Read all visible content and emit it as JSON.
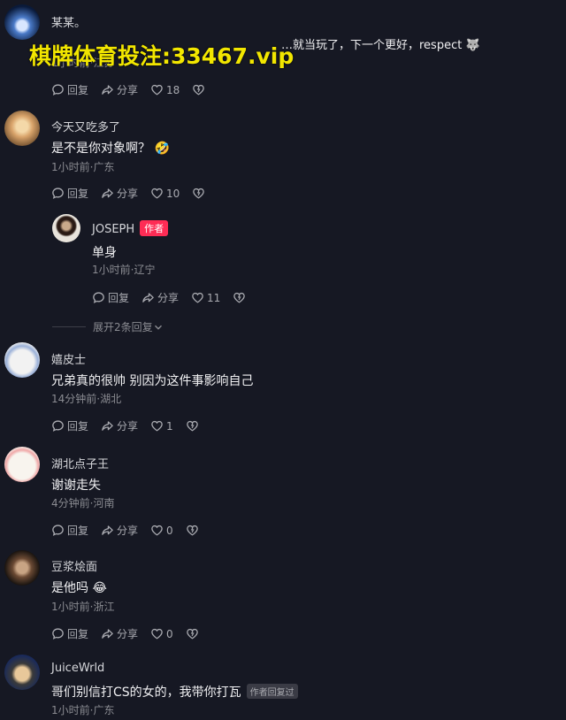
{
  "watermark": "棋牌体育投注:33467.vip",
  "comments": [
    {
      "username": "某某。",
      "text": "…就当玩了，下一个更好，respect 🐺",
      "meta": "1小时前·江苏",
      "reply": "回复",
      "share": "分享",
      "likes": "18",
      "avatar_colors": [
        "#0a1a3a",
        "#4a7ac8",
        "#d8e6ff"
      ]
    },
    {
      "username": "今天又吃多了",
      "text": "是不是你对象啊？ 🤣",
      "meta": "1小时前·广东",
      "reply": "回复",
      "share": "分享",
      "likes": "10",
      "avatar_colors": [
        "#6b4a2a",
        "#d9a46b",
        "#f4d8a8"
      ]
    },
    {
      "username": "JOSEPH",
      "author_tag": "作者",
      "text": "单身",
      "meta": "1小时前·辽宁",
      "reply": "回复",
      "share": "分享",
      "likes": "11",
      "avatar_colors": [
        "#e9e4dc",
        "#2a1a14",
        "#c9a98a"
      ]
    },
    {
      "username": "嬉皮士",
      "text": "兄弟真的很帅 别因为这件事影响自己",
      "meta": "14分钟前·湖北",
      "reply": "回复",
      "share": "分享",
      "likes": "1",
      "avatar_colors": [
        "#f2f2f2",
        "#222222",
        "#9ab0d8"
      ]
    },
    {
      "username": "湖北点子王",
      "text": "谢谢走失",
      "meta": "4分钟前·河南",
      "reply": "回复",
      "share": "分享",
      "likes": "0",
      "avatar_colors": [
        "#f8f4ee",
        "#f0a8a8",
        "#333333"
      ]
    },
    {
      "username": "豆浆烩面",
      "text": "是他吗 😂",
      "meta": "1小时前·浙江",
      "reply": "回复",
      "share": "分享",
      "likes": "0",
      "avatar_colors": [
        "#1a1410",
        "#6b4a34",
        "#c8a484"
      ]
    },
    {
      "username": "JuiceWrld",
      "text": "哥们别信打CS的女的，我带你打瓦",
      "reply_tag": "作者回复过",
      "meta": "1小时前·广东",
      "avatar_colors": [
        "#1a2a5a",
        "#e8c89a",
        "#3a3a3a"
      ]
    }
  ],
  "expand_label": "展开2条回复",
  "colors": {
    "background": "#161823",
    "author_tag": "#fe2c55",
    "watermark": "#f2e600"
  }
}
